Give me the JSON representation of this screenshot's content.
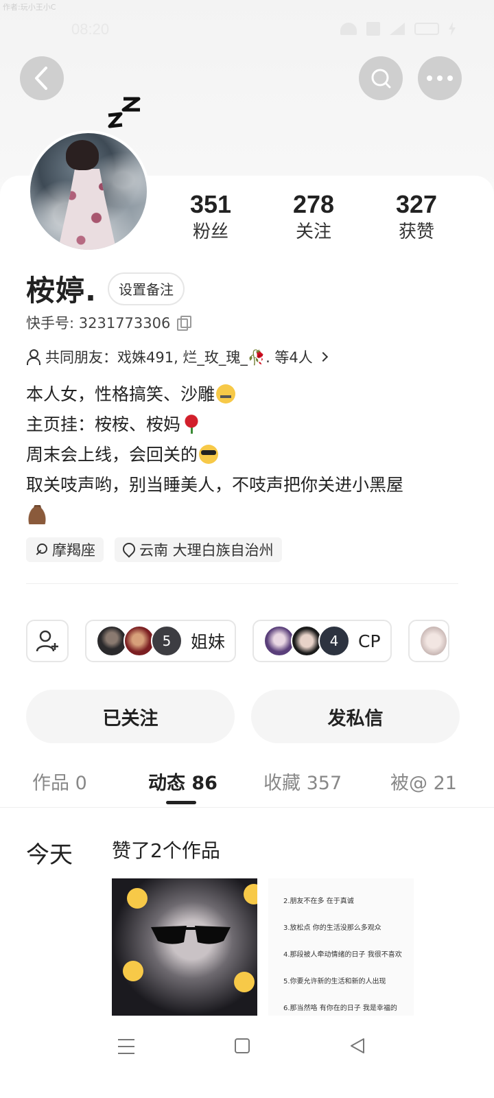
{
  "watermark": "作者:玩小王小C",
  "status": {
    "time": "08:20"
  },
  "header": {
    "back_icon": "chevron-left-icon",
    "search_icon": "search-icon",
    "more_icon": "more-dots-icon"
  },
  "profile": {
    "stats": [
      {
        "value": "351",
        "label": "粉丝"
      },
      {
        "value": "278",
        "label": "关注"
      },
      {
        "value": "327",
        "label": "获赞"
      }
    ],
    "name": "桉婷.",
    "remark_button": "设置备注",
    "id_text": "快手号: 3231773306",
    "mutual_friends": "共同朋友：戏姝491, 烂_玫_瑰_🥀. 等4人",
    "bio": [
      "本人女，性格搞笑、沙雕",
      "主页挂：桉桉、桉妈",
      "周末会上线，会回关的",
      "取关吱声哟，别当睡美人，不吱声把你关进小黑屋"
    ],
    "tags": {
      "zodiac": "摩羯座",
      "location": "云南 大理白族自治州"
    }
  },
  "groups": [
    {
      "name": "姐妹",
      "count": "5"
    },
    {
      "name": "CP",
      "count": "4"
    }
  ],
  "actions": {
    "follow": "已关注",
    "message": "发私信"
  },
  "tabs": [
    {
      "label": "作品 0",
      "active": false
    },
    {
      "label": "动态 86",
      "active": true
    },
    {
      "label": "收藏 357",
      "active": false
    },
    {
      "label": "被@ 21",
      "active": false
    }
  ],
  "feed": {
    "day": "今天",
    "title": "赞了2个作品",
    "thumb2_lines": [
      "2.朋友不在多 在于真诚",
      "3.放松点 你的生活没那么多观众",
      "4.那段被人牵动情绪的日子 我很不喜欢",
      "5.你要允许新的生活和新的人出现",
      "6.那当然咯 有你在的日子 我是幸福的"
    ]
  },
  "colors": {
    "accent": "#222222",
    "button_bg": "#f5f5f5",
    "hero_bg": "#f4f4f4"
  }
}
